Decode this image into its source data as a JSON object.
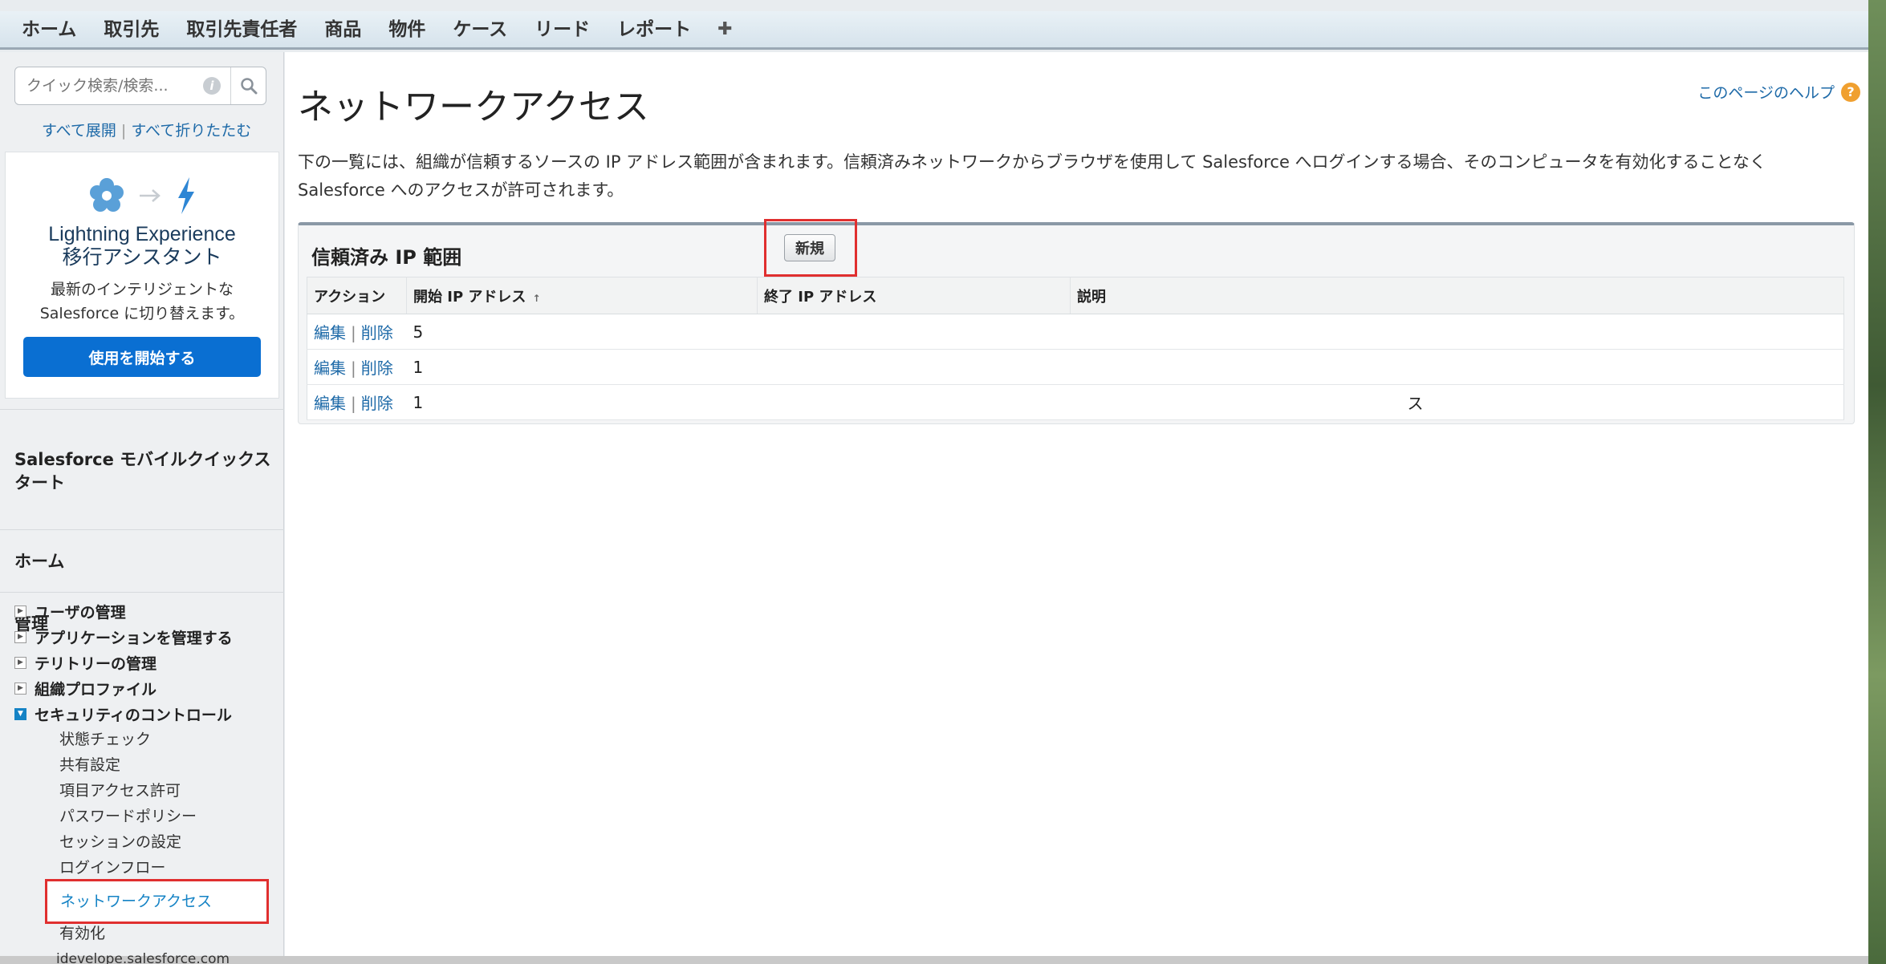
{
  "topbar": {
    "tabs": [
      "ホーム",
      "取引先",
      "取引先責任者",
      "商品",
      "物件",
      "ケース",
      "リード",
      "レポート"
    ],
    "plus_label": "✚"
  },
  "sidebar": {
    "search_placeholder": "クイック検索/検索...",
    "expand_all": "すべて展開",
    "collapse_all": "すべて折りたたむ",
    "lex": {
      "title_line1": "Lightning Experience",
      "title_line2": "移行アシスタント",
      "desc_line1": "最新のインテリジェントな",
      "desc_line2": "Salesforce に切り替えます。",
      "button": "使用を開始する"
    },
    "mobile_quickstart": "Salesforce モバイルクイックスタート",
    "home": "ホーム",
    "admin": "管理",
    "tree": [
      {
        "label": "ユーザの管理",
        "open": false
      },
      {
        "label": "アプリケーションを管理する",
        "open": false
      },
      {
        "label": "テリトリーの管理",
        "open": false
      },
      {
        "label": "組織プロファイル",
        "open": false
      },
      {
        "label": "セキュリティのコントロール",
        "open": true
      }
    ],
    "security_children": [
      "状態チェック",
      "共有設定",
      "項目アクセス許可",
      "パスワードポリシー",
      "セッションの設定",
      "ログインフロー"
    ],
    "active_item": "ネットワークアクセス",
    "after_active": "有効化"
  },
  "main": {
    "title": "ネットワークアクセス",
    "help": "このページのヘルプ",
    "description": "下の一覧には、組織が信頼するソースの IP アドレス範囲が含まれます。信頼済みネットワークからブラウザを使用して Salesforce へログインする場合、そのコンピュータを有効化することなく Salesforce へのアクセスが許可されます。",
    "panel_title": "信頼済み IP 範囲",
    "new_button": "新規",
    "columns": [
      "アクション",
      "開始 IP アドレス",
      "終了 IP アドレス",
      "説明"
    ],
    "rows": [
      {
        "edit": "編集",
        "delete": "削除",
        "start": "5",
        "end": "",
        "desc": ""
      },
      {
        "edit": "編集",
        "delete": "削除",
        "start": "1",
        "end": "",
        "desc": ""
      },
      {
        "edit": "編集",
        "delete": "削除",
        "start": "1",
        "end": "",
        "desc": "ス"
      }
    ]
  },
  "footer": {
    "text": "idevelope.salesforce.com"
  }
}
